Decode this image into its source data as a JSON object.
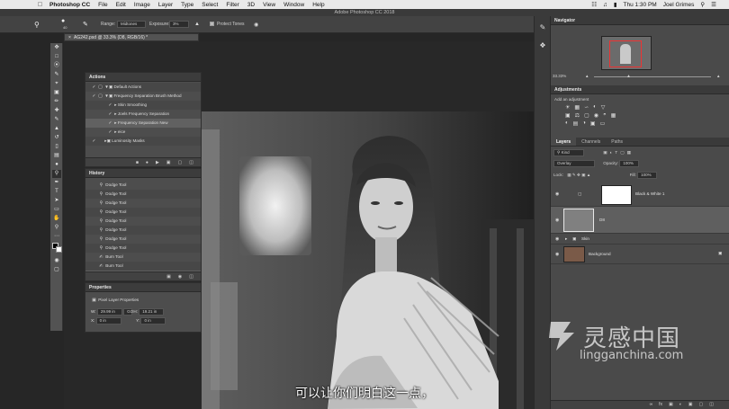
{
  "menubar": {
    "app": "Photoshop CC",
    "items": [
      "File",
      "Edit",
      "Image",
      "Layer",
      "Type",
      "Select",
      "Filter",
      "3D",
      "View",
      "Window",
      "Help"
    ],
    "clock": "Thu 1:30 PM",
    "user": "Joel Grimes"
  },
  "window_title": "Adobe Photoshop CC 2018",
  "options": {
    "brush_size": "40",
    "range_label": "Range:",
    "range_value": "Midtones",
    "exposure_label": "Exposure:",
    "exposure_value": "3%",
    "protect_tones": "Protect Tones"
  },
  "document_tab": "AG242.psd @ 33.3% (D8, RGB/16) *",
  "actions": {
    "title": "Actions",
    "items": [
      "Default Actions",
      "Frequency Separation Brush Method",
      "Skin Smoothing",
      "Joels Frequency Separation",
      "Frequency Separation New",
      "eice",
      "Luminosity Masks"
    ]
  },
  "history": {
    "title": "History",
    "items": [
      "Dodge Tool",
      "Dodge Tool",
      "Dodge Tool",
      "Dodge Tool",
      "Dodge Tool",
      "Dodge Tool",
      "Dodge Tool",
      "Dodge Tool",
      "Burn Tool",
      "Burn Tool",
      "Dodge Tool"
    ]
  },
  "properties": {
    "title": "Properties",
    "subtitle": "Pixel Layer Properties",
    "w_label": "W:",
    "w_value": "29.99 in",
    "h_label": "H:",
    "h_value": "19.21 in",
    "x_label": "X:",
    "x_value": "0 in",
    "y_label": "Y:",
    "y_value": "0 in",
    "go_label": "GO"
  },
  "navigator": {
    "title": "Navigator",
    "zoom": "33.33%"
  },
  "adjustments": {
    "title": "Adjustments",
    "subtitle": "Add an adjustment"
  },
  "layers": {
    "tabs": [
      "Layers",
      "Channels",
      "Paths"
    ],
    "filter": "Kind",
    "blend_mode": "Overlay",
    "opacity_label": "Opacity:",
    "opacity": "100%",
    "lock_label": "Lock:",
    "fill_label": "Fill:",
    "fill": "100%",
    "items": [
      {
        "name": "Black & White 1"
      },
      {
        "name": "D8"
      },
      {
        "name": "Skin"
      },
      {
        "name": "Background"
      }
    ]
  },
  "subtitle": "可以让你们明白这一点，",
  "watermark": {
    "cn": "灵感中国",
    "en": "lingganchina.com"
  },
  "colors": {
    "accent": "#1f6fd6",
    "panel": "#4d4d4d",
    "menubar": "#e9e9e9"
  }
}
